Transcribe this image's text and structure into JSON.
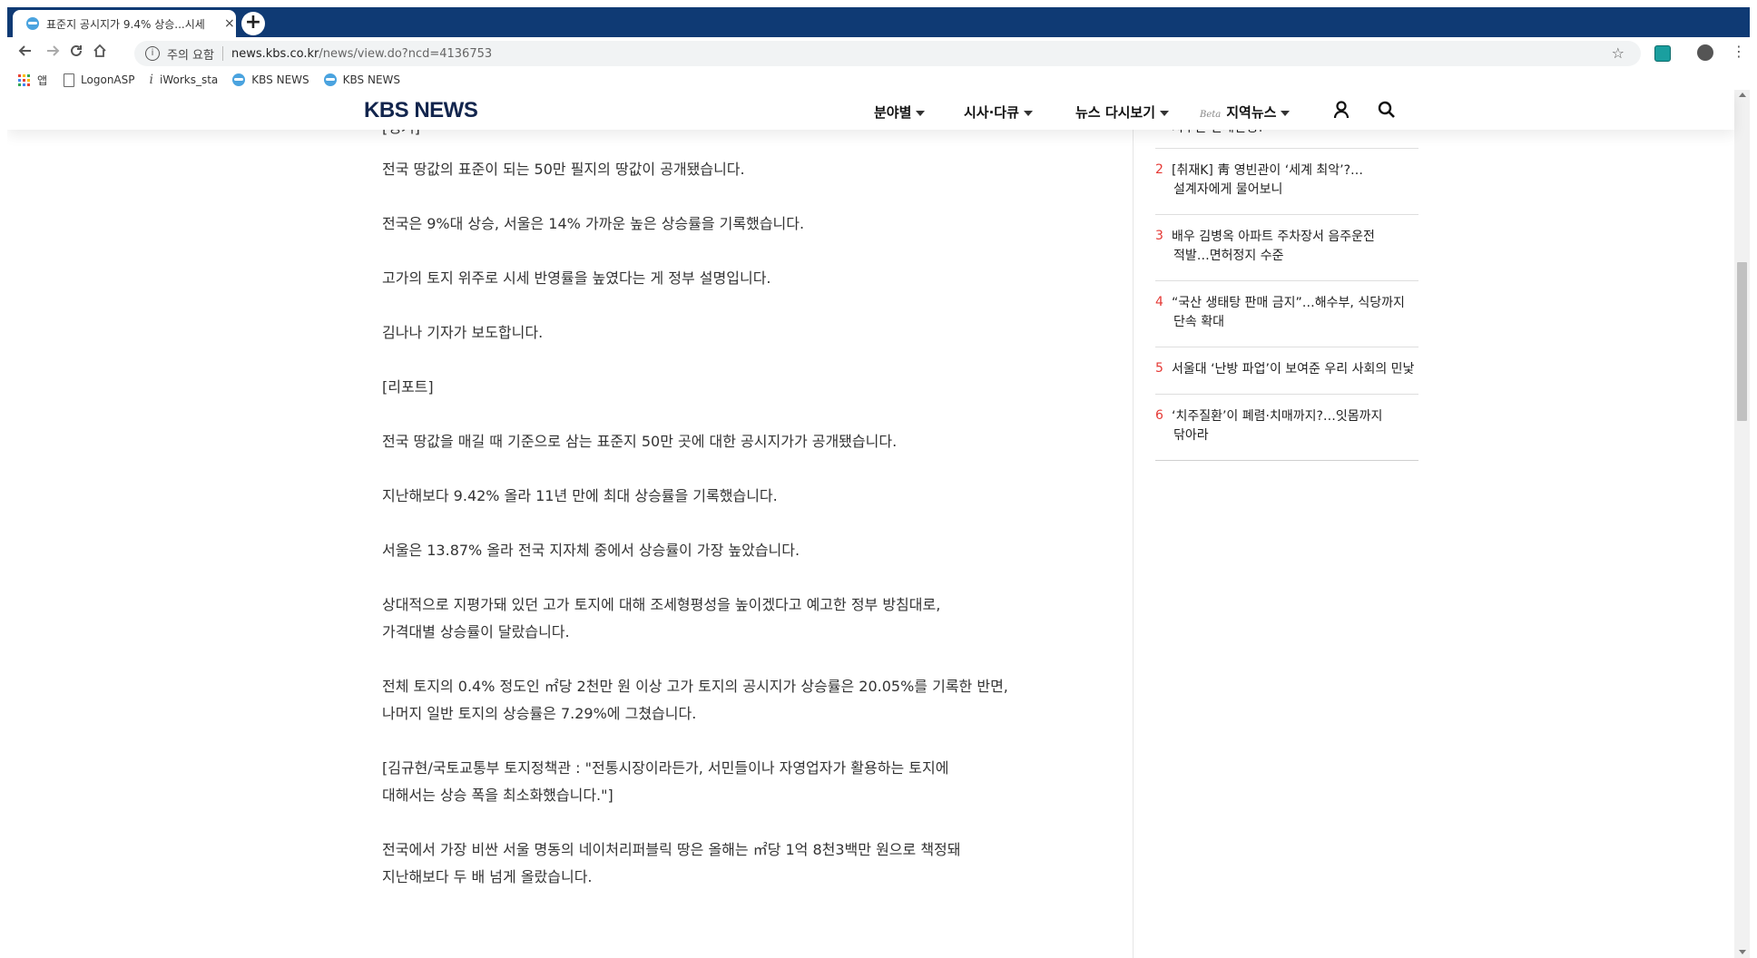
{
  "browser": {
    "tab_title": "표준지 공시지가 9.4% 상승...시세",
    "tab_close": "×",
    "new_tab": "+",
    "security_label": "주의 요함",
    "url_host": "news.kbs.co.kr",
    "url_path": "/news/view.do?ncd=4136753",
    "bookmarks": [
      {
        "label": "앱",
        "icon": "apps-icon"
      },
      {
        "label": "LogonASP",
        "icon": "page-icon"
      },
      {
        "label": "iWorks_sta",
        "icon": "iworks-icon"
      },
      {
        "label": "KBS NEWS",
        "icon": "kbs-icon"
      },
      {
        "label": "KBS NEWS",
        "icon": "kbs-icon"
      }
    ]
  },
  "site": {
    "logo": "KBS NEWS",
    "nav": [
      {
        "label": "분야별"
      },
      {
        "label": "시사·다큐"
      },
      {
        "label": "뉴스 다시보기"
      },
      {
        "label": "지역뉴스",
        "badge": "Beta"
      }
    ]
  },
  "article": {
    "paragraphs": [
      {
        "text": "[앵커]"
      },
      {
        "text": "전국 땅값의 표준이 되는 50만 필지의 땅값이 공개됐습니다."
      },
      {
        "text": "전국은 9%대 상승, 서울은 14% 가까운 높은 상승률을 기록했습니다."
      },
      {
        "text": "고가의 토지 위주로 시세 반영률을 높였다는 게 정부 설명입니다."
      },
      {
        "text": "김나나 기자가 보도합니다."
      },
      {
        "text": "[리포트]"
      },
      {
        "text": "전국 땅값을 매길 때 기준으로 삼는 표준지 50만 곳에 대한 공시지가가 공개됐습니다."
      },
      {
        "text": "지난해보다 9.42% 올라 11년 만에 최대 상승률을 기록했습니다."
      },
      {
        "text": "서울은 13.87% 올라 전국 지자체 중에서 상승률이 가장 높았습니다."
      },
      {
        "text": "상대적으로 지평가돼 있던 고가 토지에 대해 조세형평성을 높이겠다고 예고한 정부 방침대로,"
      },
      {
        "text": "가격대별 상승률이 달랐습니다."
      },
      {
        "text": "전체 토지의 0.4% 정도인 ㎡당 2천만 원 이상 고가 토지의 공시지가 상승률은 20.05%를 기록한 반면,"
      },
      {
        "text": "나머지 일반 토지의 상승률은 7.29%에 그쳤습니다."
      },
      {
        "text": "[김규현/국토교통부 토지정책관 : \"전통시장이라든가, 서민들이나 자영업자가 활용하는 토지에"
      },
      {
        "text": "대해서는 상승 폭을 최소화했습니다.\"]"
      },
      {
        "text": "전국에서 가장 비싼 서울 명동의 네이처리퍼블릭 땅은 올해는 ㎡당 1억 8천3백만 원으로 책정돼"
      },
      {
        "text": "지난해보다 두 배 넘게 올랐습니다."
      }
    ]
  },
  "sidebar": {
    "ranking": [
      {
        "num": "",
        "lines": [
          "치우는 관세전쟁?"
        ]
      },
      {
        "num": "2",
        "lines": [
          "[취재K] 靑 영빈관이 ‘세계 최악’?…",
          "설계자에게 물어보니"
        ]
      },
      {
        "num": "3",
        "lines": [
          "배우 김병옥 아파트 주차장서 음주운전",
          "적발…면허정지 수준"
        ]
      },
      {
        "num": "4",
        "lines": [
          "“국산 생태탕 판매 금지”…해수부, 식당까지",
          "단속 확대"
        ]
      },
      {
        "num": "5",
        "lines": [
          "서울대 ‘난방 파업’이 보여준 우리 사회의 민낯"
        ]
      },
      {
        "num": "6",
        "lines": [
          "‘치주질환’이 폐렴·치매까지?…잇몸까지",
          "닦아라"
        ]
      }
    ]
  },
  "colors": {
    "tabstrip": "#0f3a74",
    "logo": "#12254d",
    "rank_number": "#e53935"
  }
}
